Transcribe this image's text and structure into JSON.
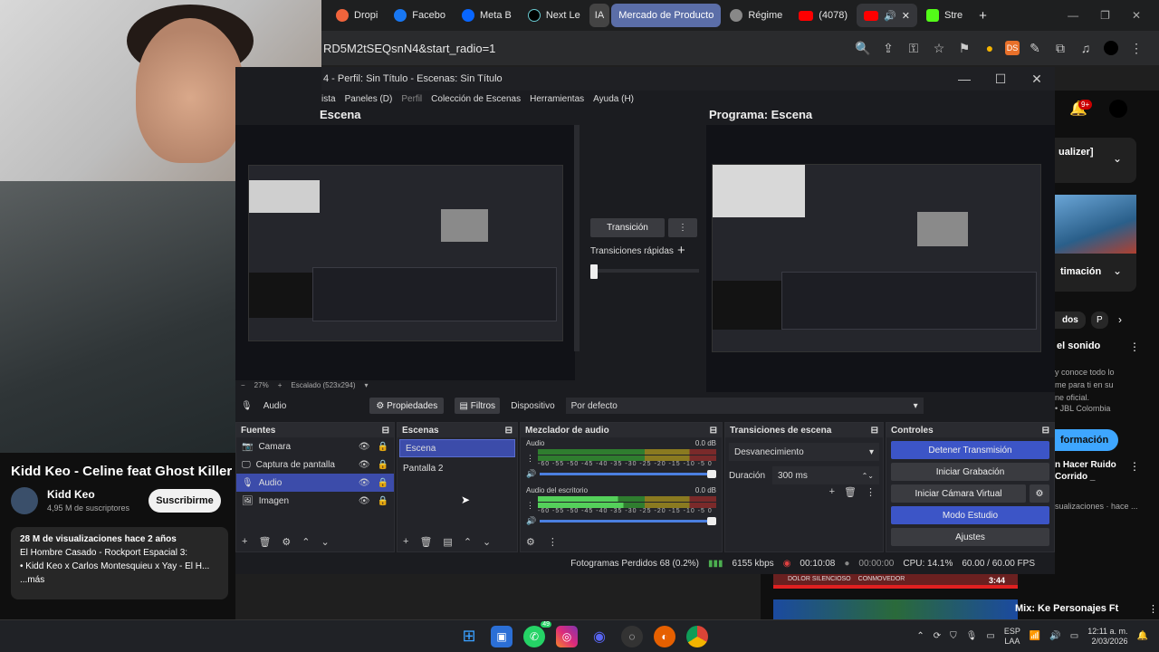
{
  "browser": {
    "tabs": [
      {
        "label": "Dropi",
        "color": "#f0643c"
      },
      {
        "label": "Facebo",
        "color": "#1877f2"
      },
      {
        "label": "Meta B",
        "color": "#0866ff"
      },
      {
        "label": "Next Le",
        "color": "#000000"
      },
      {
        "label": "IA",
        "color": "#666666"
      },
      {
        "label": "Mercado de Producto",
        "color": "#5b6ea8"
      },
      {
        "label": "Régime",
        "color": "#888888"
      },
      {
        "label": "(4078)",
        "color": "#ff0000"
      },
      {
        "label": "Stre",
        "color": "#53fc18"
      }
    ],
    "url": "RD5M2tSEQsnN4&start_radio=1",
    "ext_label": "DS"
  },
  "obs": {
    "title": "4 - Perfil: Sin Título - Escenas: Sin Título",
    "menu": [
      "ista",
      "Paneles (D)",
      "Perfil",
      "Colección de Escenas",
      "Herramientas",
      "Ayuda (H)"
    ],
    "preview_label": "Escena",
    "program_label": "Programa: Escena",
    "transition_button": "Transición",
    "quick_transitions": "Transiciones rápidas",
    "zoom": "27%",
    "scaling": "Escalado (523x294)",
    "source_bar": {
      "name": "Audio",
      "properties": "Propiedades",
      "filters": "Filtros",
      "device_label": "Dispositivo",
      "device_value": "Por defecto"
    },
    "sources": {
      "title": "Fuentes",
      "items": [
        {
          "name": "Camara",
          "selected": false
        },
        {
          "name": "Captura de pantalla",
          "selected": false
        },
        {
          "name": "Audio",
          "selected": true
        },
        {
          "name": "Imagen",
          "selected": false
        }
      ]
    },
    "scenes": {
      "title": "Escenas",
      "items": [
        {
          "name": "Escena",
          "selected": true
        },
        {
          "name": "Pantalla 2",
          "selected": false
        }
      ]
    },
    "mixer": {
      "title": "Mezclador de audio",
      "channels": [
        {
          "name": "Audio",
          "db": "0.0 dB"
        },
        {
          "name": "Audio del escritorio",
          "db": "0.0 dB"
        }
      ],
      "scale": "-60 -55 -50 -45 -40 -35 -30 -25 -20 -15 -10 -5 0"
    },
    "transitions": {
      "title": "Transiciones de escena",
      "type": "Desvanecimiento",
      "duration_label": "Duración",
      "duration_value": "300 ms"
    },
    "controls": {
      "title": "Controles",
      "buttons": [
        "Detener Transmisión",
        "Iniciar Grabación",
        "Iniciar Cámara Virtual",
        "Modo Estudio",
        "Ajustes"
      ]
    },
    "status": {
      "dropped": "Fotogramas Perdidos 68 (0.2%)",
      "kbps": "6155 kbps",
      "live": "00:10:08",
      "rec": "00:00:00",
      "cpu": "CPU: 14.1%",
      "fps": "60.00 / 60.00 FPS"
    }
  },
  "youtube": {
    "video_title": "Kidd Keo - Celine feat Ghost Killer Tr",
    "channel": "Kidd Keo",
    "subscribers": "4,95 M de suscriptores",
    "subscribe": "Suscribirme",
    "views": "28 M de visualizaciones  hace 2 años",
    "desc1": "El Hombre Casado - Rockport Espacial 3:",
    "desc2": "• Kidd Keo x Carlos Montesquieu x Yay - El H...",
    "more": "...más",
    "right": {
      "badge": "9+",
      "card1": "ualizer]",
      "card2": "timación",
      "chip1": "dos",
      "chip2": "P",
      "sound_title": "el sonido",
      "sound_desc": "y conoce todo lo\nme para ti en su\nne oficial.",
      "jbl": "• JBL Colombia",
      "info_button": "formación",
      "rec_title": "n Hacer Ruido\nCorrido _",
      "rec_meta": "sualizaciones · hace ...",
      "duration": "3:44",
      "bottom_title": "Mix: Ke Personajes Ft",
      "tag1": "DOLOR SILENCIOSO",
      "tag2": "CONMOVEDOR"
    }
  },
  "taskbar": {
    "whatsapp_badge": "49",
    "lang": "ESP",
    "lang2": "LAA",
    "time": "12:11 a. m.",
    "date": "2/03/2026"
  }
}
